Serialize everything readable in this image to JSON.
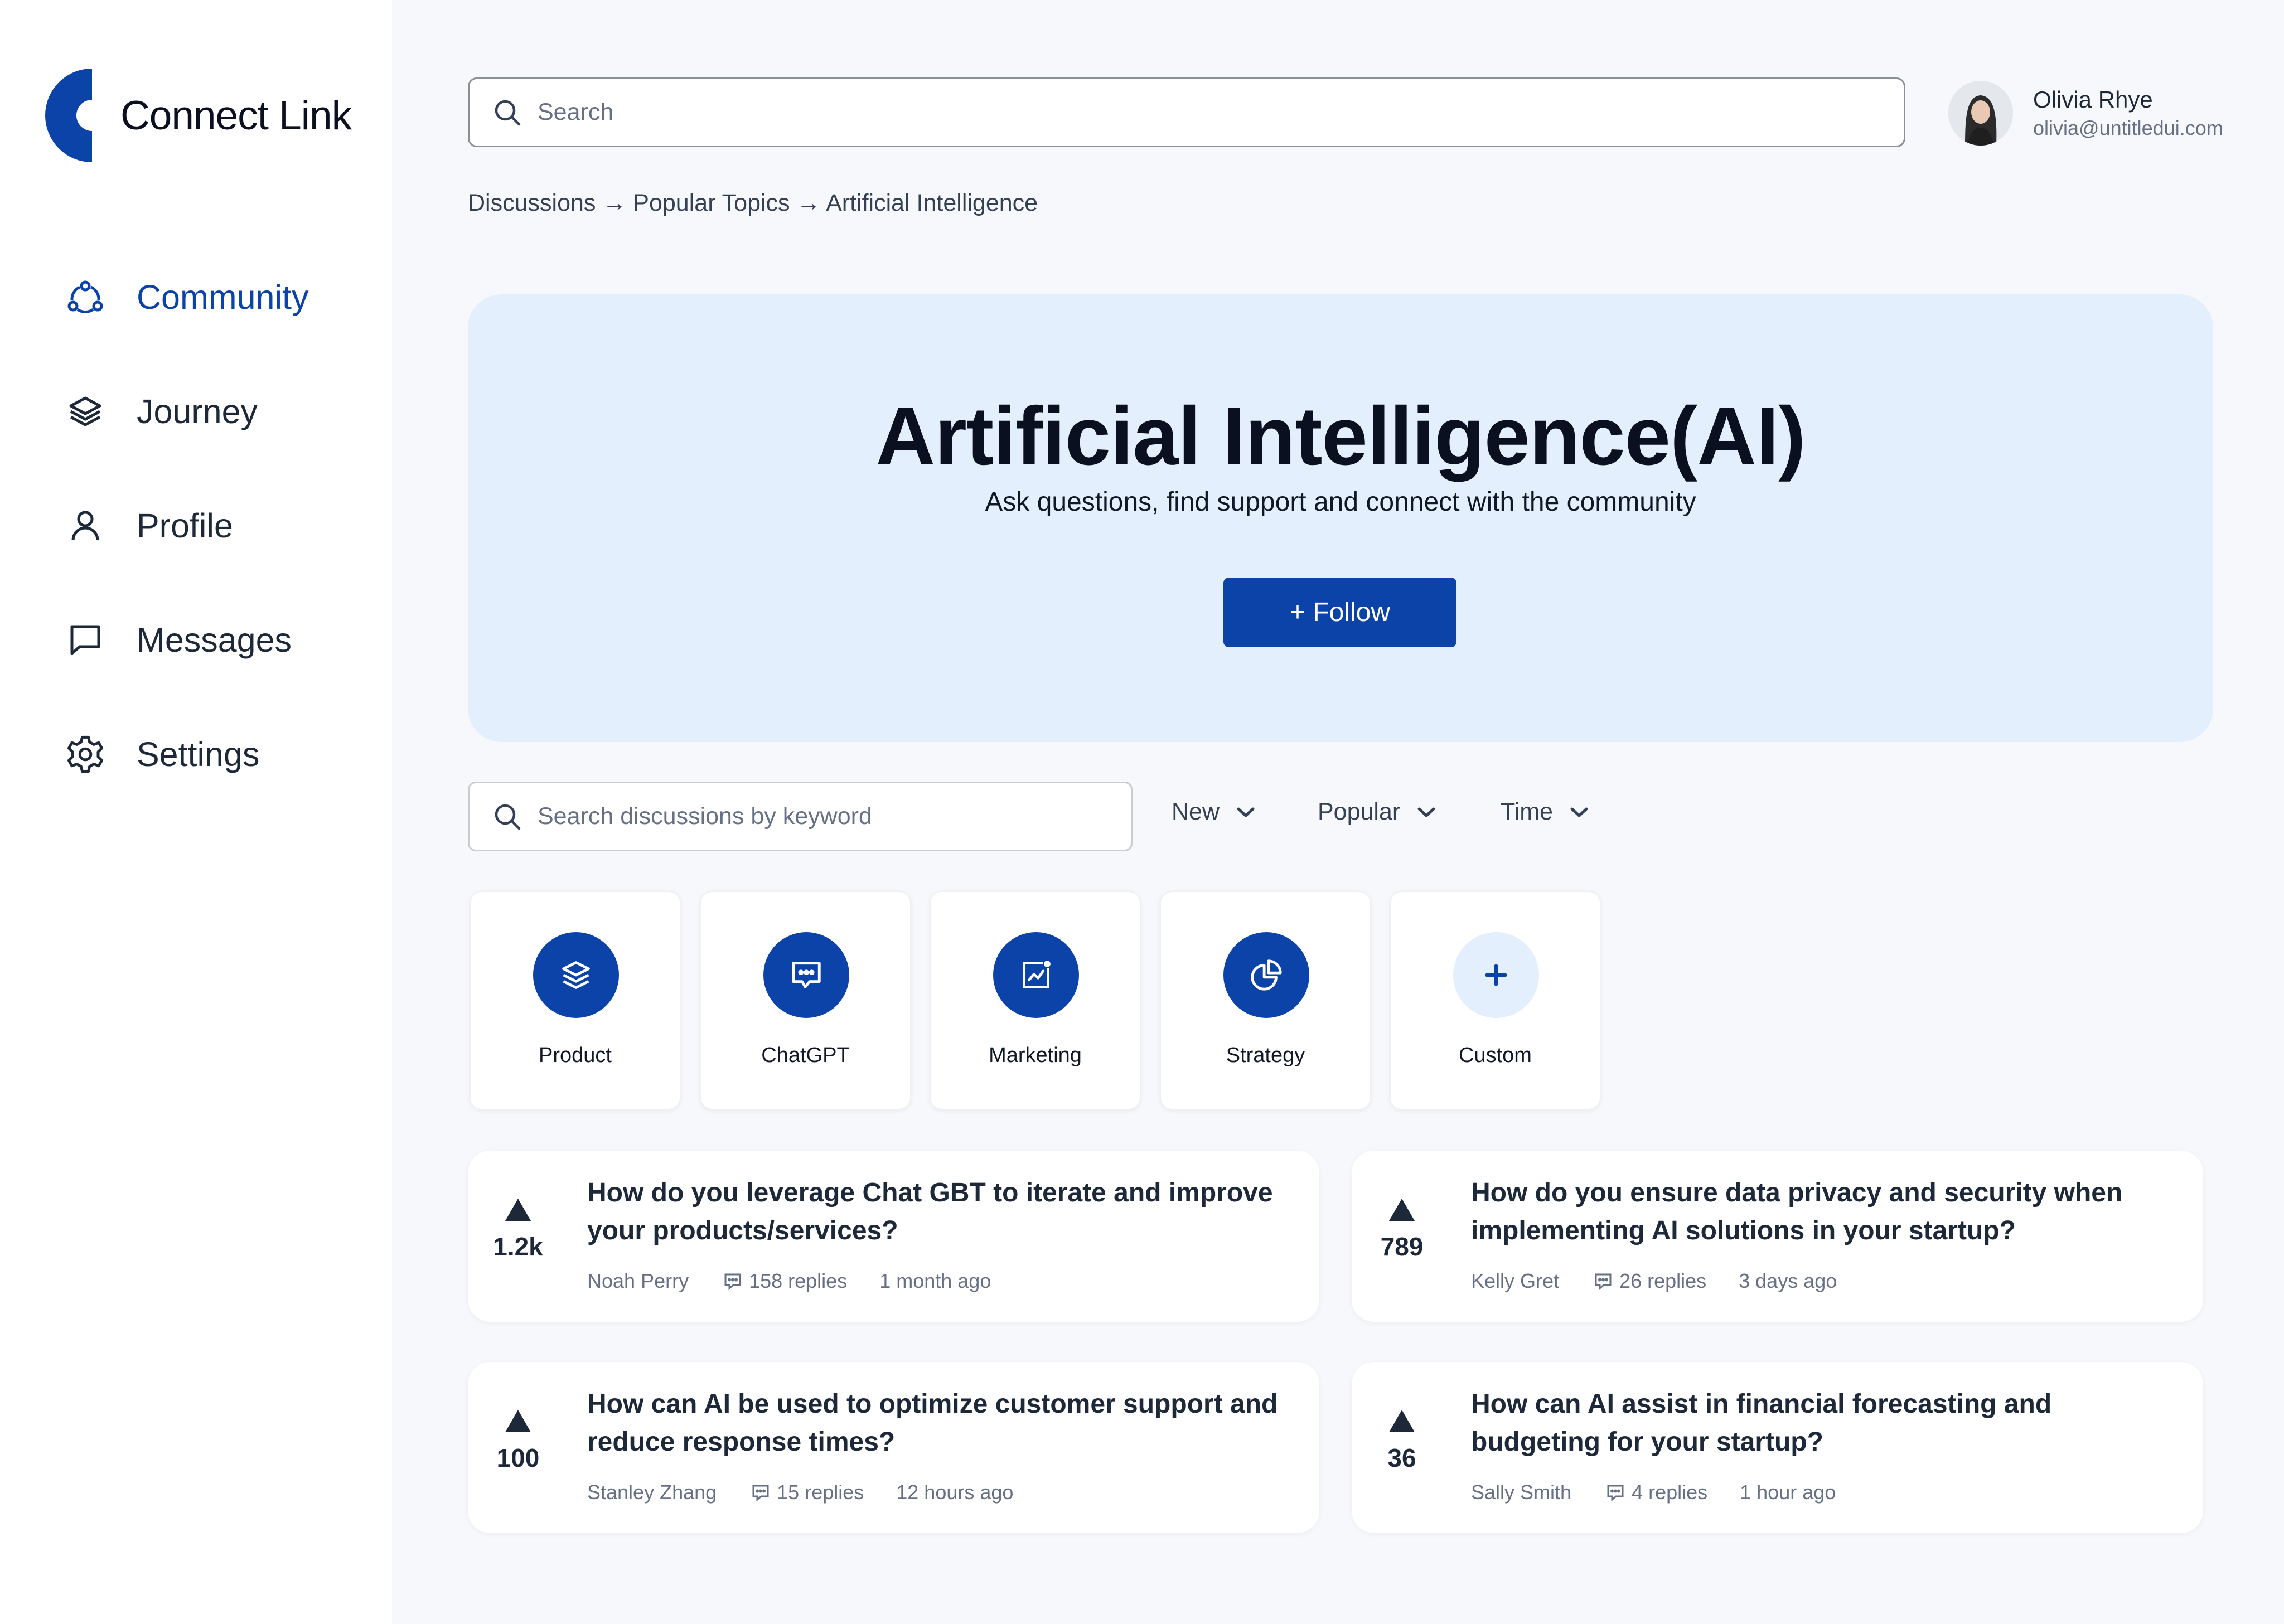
{
  "brand": {
    "name": "Connect Link",
    "accent": "#0b43a8"
  },
  "nav": [
    {
      "label": "Community",
      "icon": "community-icon",
      "active": true
    },
    {
      "label": "Journey",
      "icon": "layers-icon",
      "active": false
    },
    {
      "label": "Profile",
      "icon": "user-icon",
      "active": false
    },
    {
      "label": "Messages",
      "icon": "message-icon",
      "active": false
    },
    {
      "label": "Settings",
      "icon": "gear-icon",
      "active": false
    }
  ],
  "search": {
    "placeholder": "Search"
  },
  "user": {
    "name": "Olivia Rhye",
    "email": "olivia@untitledui.com"
  },
  "breadcrumb": "Discussions → Popular Topics → Artificial Intelligence",
  "hero": {
    "title": "Artificial Intelligence(AI)",
    "subtitle": "Ask questions, find support and connect with the community",
    "follow_label": "+ Follow"
  },
  "discussion_search": {
    "placeholder": "Search discussions by keyword"
  },
  "filters": [
    "New",
    "Popular",
    "Time"
  ],
  "categories": [
    {
      "label": "Product",
      "icon": "layers-icon"
    },
    {
      "label": "ChatGPT",
      "icon": "chat-icon"
    },
    {
      "label": "Marketing",
      "icon": "chart-icon"
    },
    {
      "label": "Strategy",
      "icon": "pie-icon"
    },
    {
      "label": "Custom",
      "icon": "plus-icon"
    }
  ],
  "discussions": [
    {
      "votes": "1.2k",
      "title": "How do you leverage Chat GBT to iterate and improve your products/services?",
      "author": "Noah Perry",
      "replies": "158 replies",
      "time": "1 month ago"
    },
    {
      "votes": "789",
      "title": "How do you ensure data privacy and security when implementing AI solutions in your startup?",
      "author": "Kelly Gret",
      "replies": "26 replies",
      "time": "3 days ago"
    },
    {
      "votes": "100",
      "title": "How can AI be used to optimize customer support and reduce response times?",
      "author": "Stanley Zhang",
      "replies": "15 replies",
      "time": "12 hours ago"
    },
    {
      "votes": "36",
      "title": "How can AI assist in financial forecasting and budgeting for your startup?",
      "author": "Sally Smith",
      "replies": "4 replies",
      "time": "1 hour ago"
    }
  ]
}
